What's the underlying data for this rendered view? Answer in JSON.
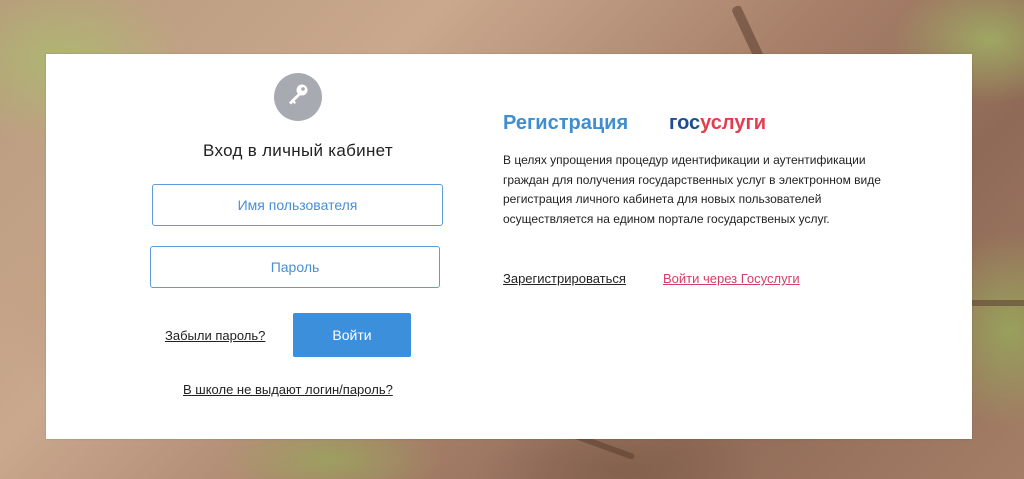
{
  "login": {
    "title": "Вход в личный кабинет",
    "username_placeholder": "Имя пользователя",
    "password_placeholder": "Пароль",
    "forgot_label": "Забыли пароль?",
    "submit_label": "Войти",
    "school_link": "В школе не выдают логин/пароль?",
    "avatar_icon": "key-icon"
  },
  "registration": {
    "title": "Регистрация",
    "logo_part1": "гос",
    "logo_part2": "услуги",
    "description": "В целях упрощения процедур идентификации и аутентификации граждан для получения государственных услуг в электронном виде регистрация личного кабинета для новых пользователей осуществляется на едином портале государственых услуг.",
    "register_link": "Зарегистрироваться",
    "gosuslugi_link": "Войти через Госуслуги"
  },
  "colors": {
    "accent": "#3c8fdb",
    "logo_dark": "#1d4d8f",
    "logo_red": "#e23d4f",
    "link_pink": "#d43d66"
  }
}
